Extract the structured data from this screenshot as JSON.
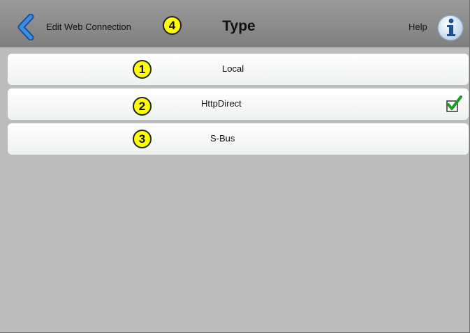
{
  "header": {
    "back_label": "Edit Web Connection",
    "title": "Type",
    "help_label": "Help"
  },
  "badges": [
    "1",
    "2",
    "3",
    "4"
  ],
  "options": [
    {
      "label": "Local",
      "selected": false
    },
    {
      "label": "HttpDirect",
      "selected": true
    },
    {
      "label": "S-Bus",
      "selected": false
    }
  ],
  "colors": {
    "background": "#bcbcbc",
    "header": "#8c8c8c",
    "badge": "#ffff00",
    "back_arrow": "#2a6fc4",
    "check": "#1e9a2a"
  },
  "icons": [
    "back-chevron-icon",
    "info-icon",
    "checkmark-icon"
  ]
}
